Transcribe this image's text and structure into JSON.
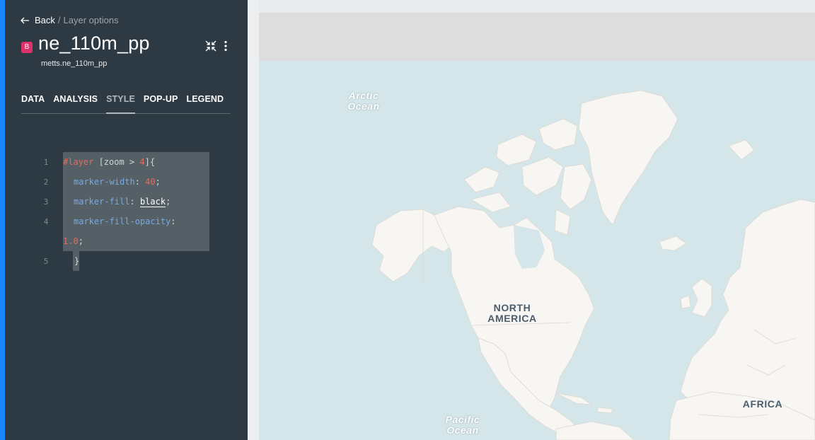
{
  "breadcrumb": {
    "back_label": "Back",
    "separator": "/",
    "current": "Layer options"
  },
  "layer": {
    "badge": "B",
    "name": "ne_110m_pp",
    "source": "metts.ne_110m_pp"
  },
  "tabs": [
    {
      "label": "DATA",
      "active": false
    },
    {
      "label": "ANALYSIS",
      "active": false
    },
    {
      "label": "STYLE",
      "active": true
    },
    {
      "label": "POP-UP",
      "active": false
    },
    {
      "label": "LEGEND",
      "active": false
    }
  ],
  "editor": {
    "line_numbers": [
      "1",
      "2",
      "3",
      "4",
      "5"
    ],
    "line1": {
      "selector": "#layer",
      "filter_open": " [zoom > ",
      "filter_num": "4",
      "filter_close": "]{"
    },
    "line2": {
      "prop": "marker-width",
      "colon": ": ",
      "num": "40",
      "end": ";"
    },
    "line3": {
      "prop": "marker-fill",
      "colon": ": ",
      "val": "black",
      "end": ";"
    },
    "line4": {
      "prop": "marker-fill-opacity",
      "colon": ":"
    },
    "line4b": {
      "num": "1.0",
      "end": ";"
    },
    "line5": {
      "text": "}"
    }
  },
  "map": {
    "labels": {
      "arctic_1": "Arctic",
      "arctic_2": "Ocean",
      "pacific_1": "Pacific",
      "pacific_2": "Ocean",
      "na_1": "NORTH",
      "na_2": "AMERICA",
      "africa": "AFRICA"
    }
  },
  "colors": {
    "accent": "#1785fb",
    "sidebar": "#2e3a43",
    "badge": "#e0326a",
    "water": "#d4e6ea",
    "land": "#f7f6f2"
  }
}
